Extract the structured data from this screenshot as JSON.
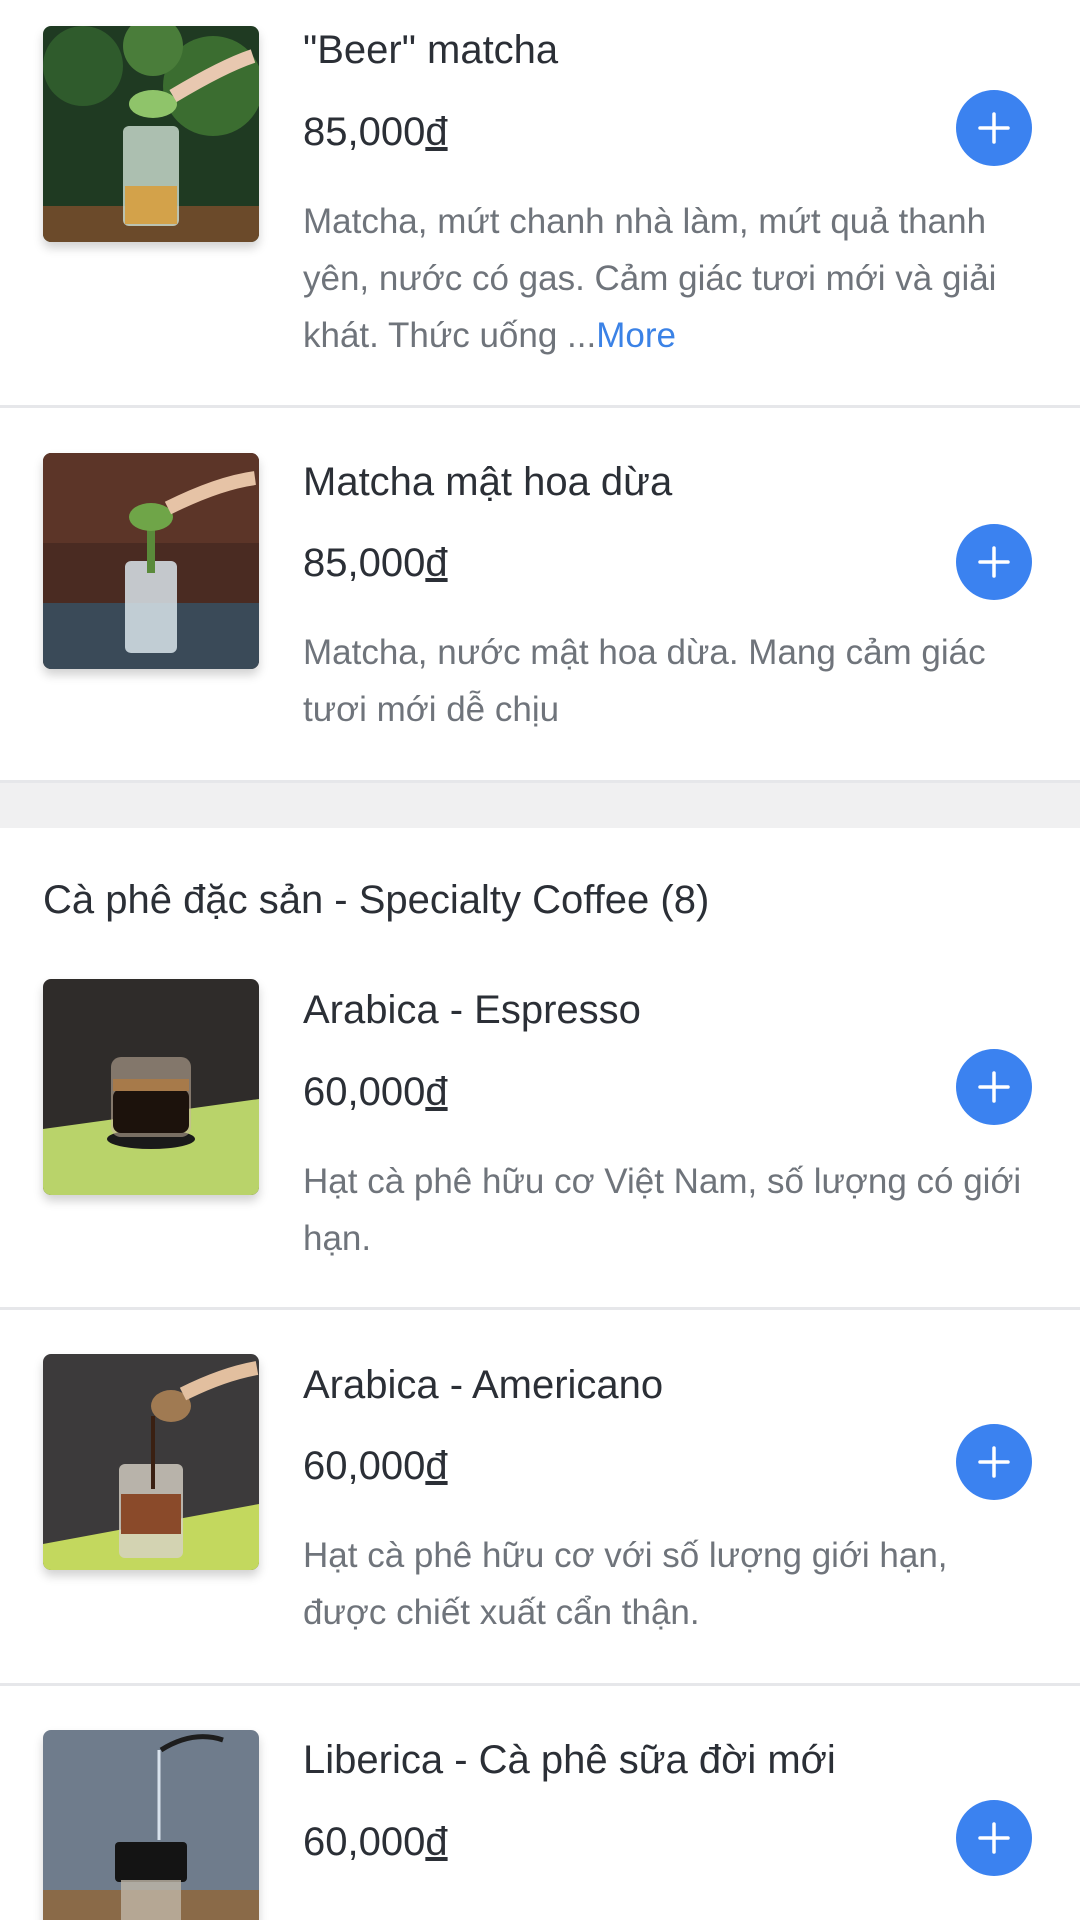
{
  "colors": {
    "accent": "#3b82f0",
    "more_link": "#3b82e6",
    "divider": "#e6e7ea",
    "section_gap": "#f0f0f1"
  },
  "items_top": [
    {
      "name": "\"Beer\" matcha",
      "price": "85,000",
      "currency": "đ",
      "description": "Matcha, mứt chanh nhà làm, mứt quả thanh yên, nước có gas. Cảm giác tươi mới và giải khát. Thức uống ...",
      "more_label": "More"
    },
    {
      "name": "Matcha mật hoa dừa",
      "price": "85,000",
      "currency": "đ",
      "description": "Matcha, nước mật hoa dừa. Mang cảm giác tươi mới dễ chịu"
    }
  ],
  "section": {
    "title": "Cà phê đặc sản - Specialty Coffee (8)"
  },
  "items_coffee": [
    {
      "name": "Arabica - Espresso",
      "price": "60,000",
      "currency": "đ",
      "description": "Hạt cà phê hữu cơ Việt Nam, số lượng có giới hạn."
    },
    {
      "name": "Arabica - Americano",
      "price": "60,000",
      "currency": "đ",
      "description": "Hạt cà phê hữu cơ với số lượng giới hạn, được chiết xuất cẩn thận."
    },
    {
      "name": "Liberica - Cà phê sữa đời mới",
      "price": "60,000",
      "currency": "đ",
      "description": ""
    }
  ],
  "icons": {
    "add": "plus-icon"
  }
}
